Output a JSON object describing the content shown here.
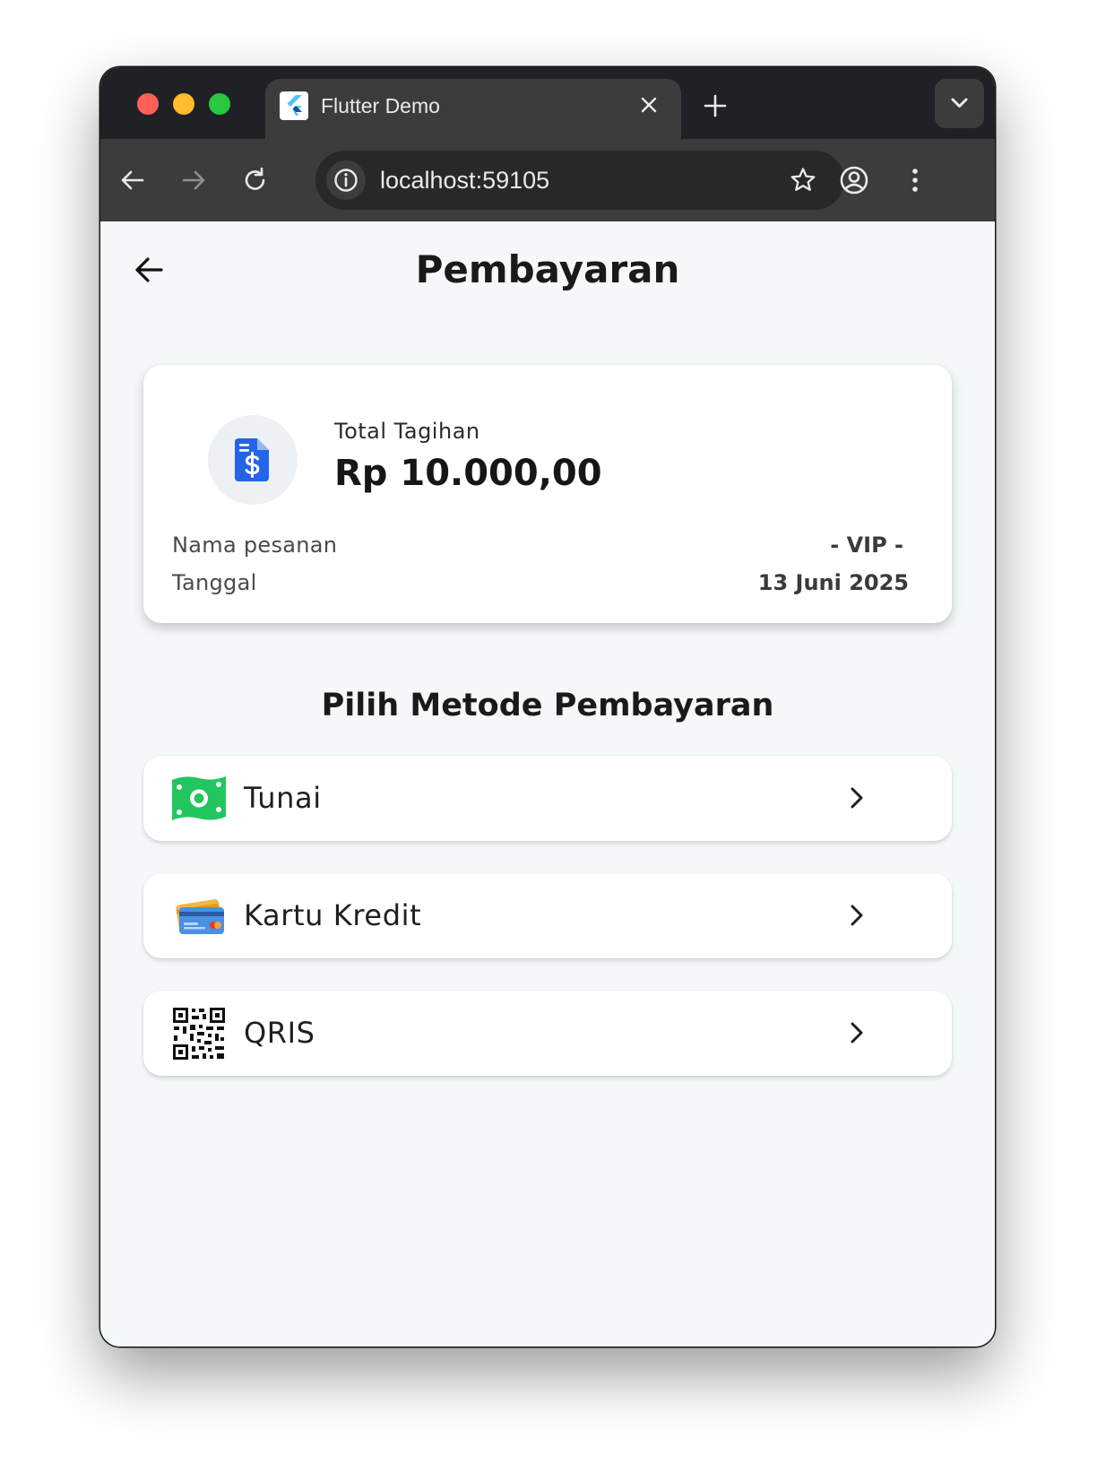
{
  "browser": {
    "tab_title": "Flutter Demo",
    "url": "localhost:59105"
  },
  "page": {
    "title": "Pembayaran"
  },
  "bill": {
    "label": "Total Tagihan",
    "amount": "Rp 10.000,00",
    "order_name_label": "Nama pesanan",
    "order_name_value": "- VIP -",
    "date_label": "Tanggal",
    "date_value": "13 Juni 2025"
  },
  "payment": {
    "section_title": "Pilih Metode Pembayaran",
    "methods": [
      {
        "label": "Tunai",
        "icon": "cash-icon"
      },
      {
        "label": "Kartu Kredit",
        "icon": "credit-card-icon"
      },
      {
        "label": "QRIS",
        "icon": "qr-code-icon"
      }
    ]
  },
  "colors": {
    "accent_blue": "#2563eb",
    "cash_green": "#22c55e",
    "page_bg": "#f4f8f8"
  }
}
